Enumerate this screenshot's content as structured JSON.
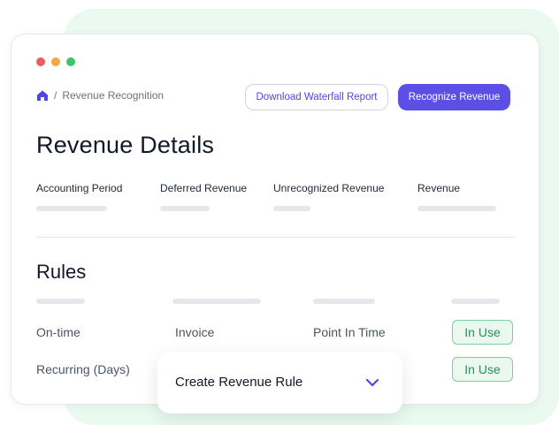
{
  "window": {
    "dots": [
      "#ef5b5b",
      "#f5a742",
      "#3cc46a"
    ]
  },
  "breadcrumb": {
    "separator": "/",
    "current": "Revenue Recognition"
  },
  "toolbar": {
    "download_label": "Download Waterfall Report",
    "recognize_label": "Recognize Revenue"
  },
  "details": {
    "title": "Revenue Details",
    "columns": [
      {
        "label": "Accounting Period"
      },
      {
        "label": "Deferred Revenue"
      },
      {
        "label": "Unrecognized Revenue"
      },
      {
        "label": "Revenue"
      }
    ]
  },
  "rules": {
    "title": "Rules",
    "rows": [
      {
        "name": "On-time",
        "source": "Invoice",
        "method": "Point In Time",
        "status": "In Use"
      },
      {
        "name": "Recurring (Days)",
        "source": "",
        "method": "",
        "status": "In Use"
      }
    ]
  },
  "popup": {
    "label": "Create Revenue Rule"
  },
  "colors": {
    "accent": "#5b4fe6",
    "status_green": "#2e8b57"
  }
}
